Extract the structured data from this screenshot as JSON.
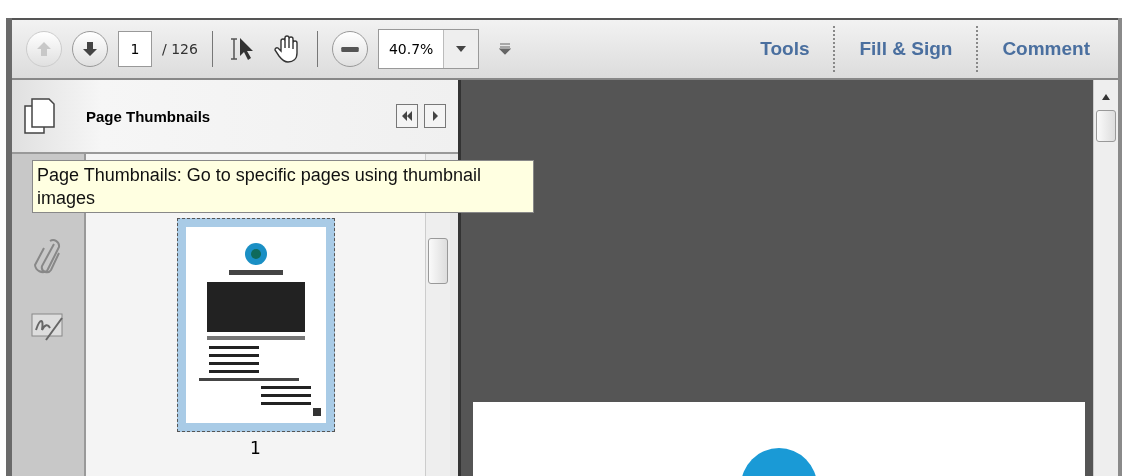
{
  "toolbar": {
    "previous_page": {
      "disabled": true
    },
    "next_page": {
      "disabled": false
    },
    "page_number": "1",
    "page_count": "/ 126",
    "zoom": "40.7%",
    "task_buttons": [
      "Tools",
      "Fill & Sign",
      "Comment"
    ]
  },
  "navigation_pane": {
    "title": "Page Thumbnails",
    "thumbnails": [
      {
        "label": "1",
        "selected": true
      }
    ]
  },
  "tooltip": "Page Thumbnails: Go to specific pages using thumbnail images"
}
